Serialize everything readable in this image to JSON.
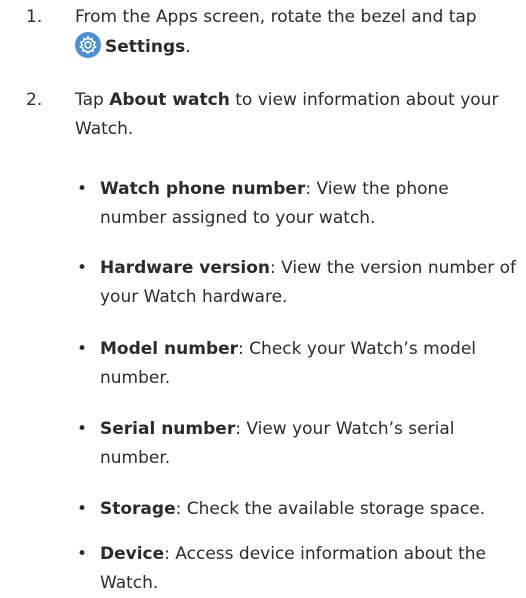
{
  "steps": [
    {
      "number": "1.",
      "text_before": "From the Apps screen, rotate the bezel and tap ",
      "icon": "settings-gear-icon",
      "bold": "Settings",
      "text_after": "."
    },
    {
      "number": "2.",
      "text_before": "Tap ",
      "bold": "About watch",
      "text_after": " to view information about your Watch."
    }
  ],
  "bullets": [
    {
      "bold": "Watch phone number",
      "text": ": View the phone number assigned to your watch."
    },
    {
      "bold": "Hardware version",
      "text": ": View the version number of your Watch hardware."
    },
    {
      "bold": "Model number",
      "text": ": Check your Watch’s model number."
    },
    {
      "bold": "Serial number",
      "text": ": View your Watch’s serial number."
    },
    {
      "bold": "Storage",
      "text": ": Check the available storage space."
    },
    {
      "bold": "Device",
      "text": ": Access device information about the Watch."
    }
  ],
  "bullet_glyph": "•",
  "colors": {
    "text": "#2b2b2b",
    "icon_background": "#4a90d9"
  }
}
